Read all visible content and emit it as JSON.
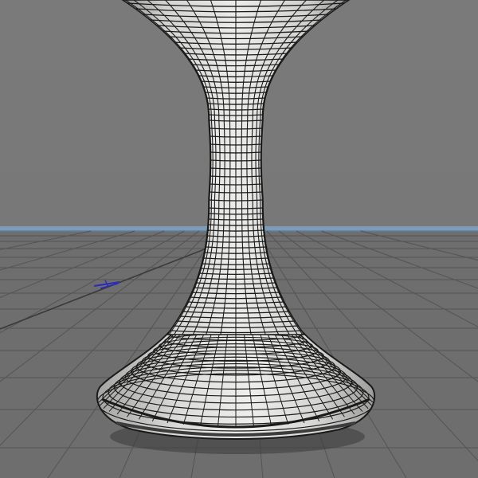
{
  "viewport": {
    "colors": {
      "background": "#7a7a7a",
      "horizon": "#7ea0c4",
      "floor": "#6e6e6e",
      "grid_line": "#545454",
      "grid_axis": "#3a3a3a",
      "mesh_fill": "#e4e4e2",
      "mesh_shade": "#9a9a9a",
      "mesh_wire": "#1a1a1a",
      "shadow": "#3a3a3a",
      "axis_gizmo": "#2b2bb8"
    },
    "objects": {
      "model": "goblet-mesh",
      "ground": "perspective-grid",
      "gizmo": "axis-gizmo-icon"
    }
  }
}
